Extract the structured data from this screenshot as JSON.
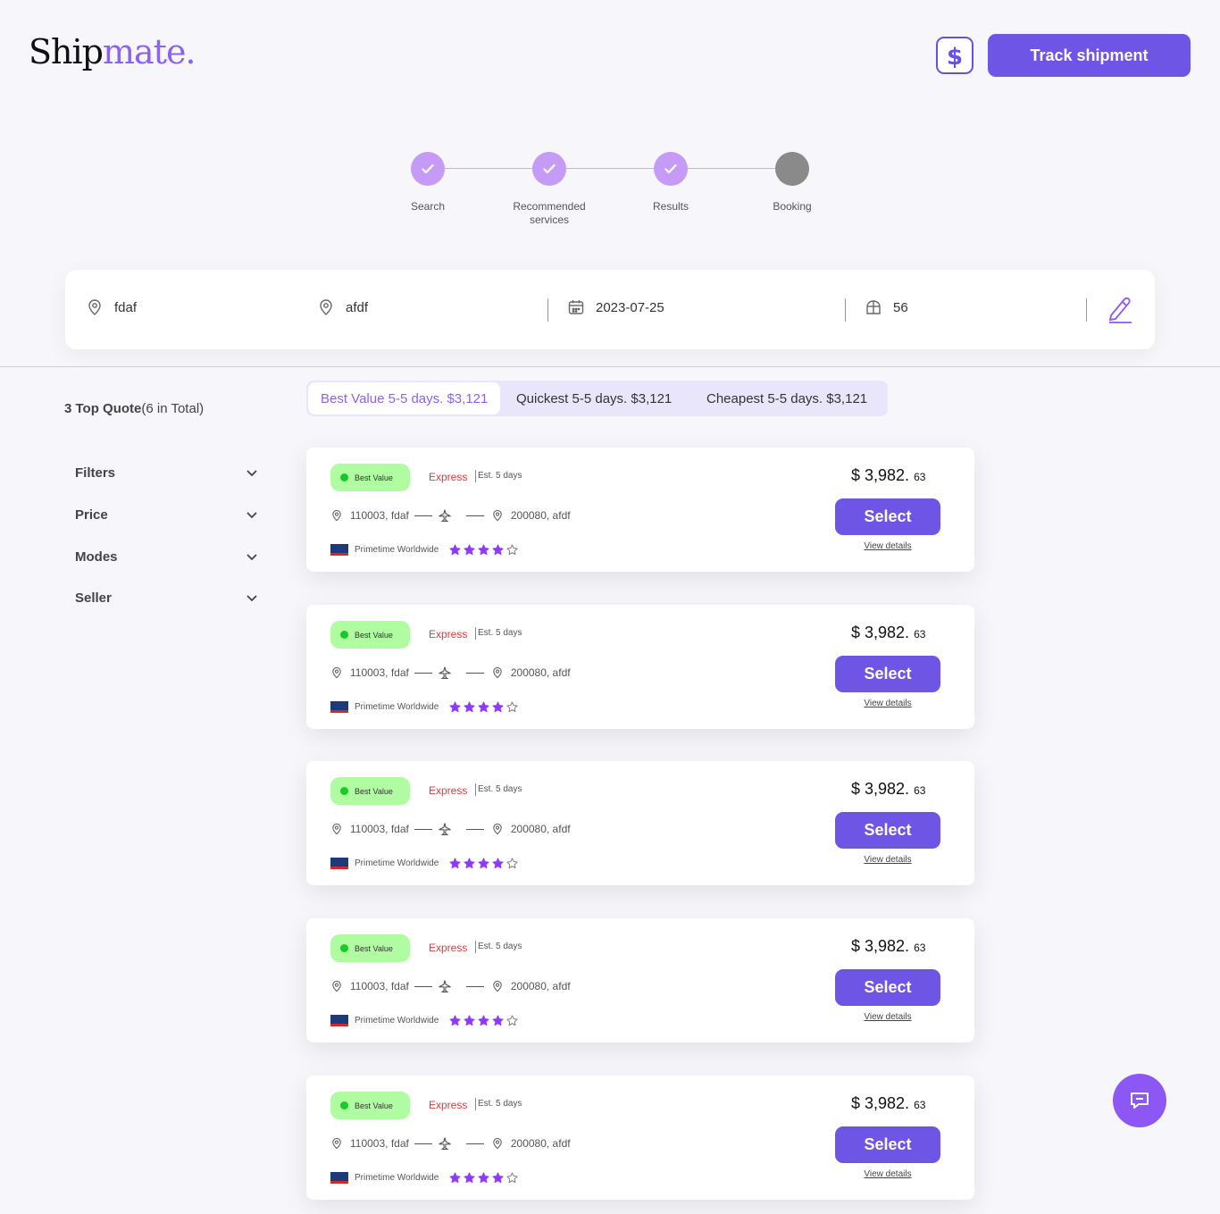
{
  "brand": {
    "part1": "Ship",
    "part2": "mate."
  },
  "header": {
    "track_label": "Track shipment"
  },
  "steps": [
    {
      "label": "Search",
      "done": true
    },
    {
      "label": "Recommended services",
      "done": true
    },
    {
      "label": "Results",
      "done": true
    },
    {
      "label": "Booking",
      "done": false
    }
  ],
  "search": {
    "origin": "fdaf",
    "destination": "afdf",
    "date": "2023-07-25",
    "weight": "56"
  },
  "summary": {
    "bold": "3 Top Quote",
    "rest": "(6 in Total)"
  },
  "filters": [
    "Filters",
    "Price",
    "Modes",
    "Seller"
  ],
  "tabs": [
    {
      "label": "Best Value 5-5 days. $3,121",
      "active": true
    },
    {
      "label": "Quickest 5-5 days. $3,121",
      "active": false
    },
    {
      "label": "Cheapest 5-5 days. $3,121",
      "active": false
    }
  ],
  "quotes": [
    {
      "badge": "Best Value",
      "mode": "Express",
      "eta": "Est. 5 days",
      "from": "110003, fdaf",
      "to": "200080, afdf",
      "carrier": "Primetime Worldwide",
      "rating": 4,
      "price_main": "$ 3,982.",
      "price_cents": "63",
      "select_label": "Select",
      "details_label": "View details"
    },
    {
      "badge": "Best Value",
      "mode": "Express",
      "eta": "Est. 5 days",
      "from": "110003, fdaf",
      "to": "200080, afdf",
      "carrier": "Primetime Worldwide",
      "rating": 4,
      "price_main": "$ 3,982.",
      "price_cents": "63",
      "select_label": "Select",
      "details_label": "View details"
    },
    {
      "badge": "Best Value",
      "mode": "Express",
      "eta": "Est. 5 days",
      "from": "110003, fdaf",
      "to": "200080, afdf",
      "carrier": "Primetime Worldwide",
      "rating": 4,
      "price_main": "$ 3,982.",
      "price_cents": "63",
      "select_label": "Select",
      "details_label": "View details"
    },
    {
      "badge": "Best Value",
      "mode": "Express",
      "eta": "Est. 5 days",
      "from": "110003, fdaf",
      "to": "200080, afdf",
      "carrier": "Primetime Worldwide",
      "rating": 4,
      "price_main": "$ 3,982.",
      "price_cents": "63",
      "select_label": "Select",
      "details_label": "View details"
    },
    {
      "badge": "Best Value",
      "mode": "Express",
      "eta": "Est. 5 days",
      "from": "110003, fdaf",
      "to": "200080, afdf",
      "carrier": "Primetime Worldwide",
      "rating": 4,
      "price_main": "$ 3,982.",
      "price_cents": "63",
      "select_label": "Select",
      "details_label": "View details"
    }
  ],
  "colors": {
    "accent": "#6f55e6",
    "brand_purple": "#8a63f0",
    "step_done": "#c59bf7",
    "badge_bg": "#b0fca0",
    "express": "#e4373a",
    "star": "#8d3cf5"
  },
  "icons": {
    "currency": "dollar-icon",
    "location": "location-pin-icon",
    "calendar": "calendar-icon",
    "package": "package-icon",
    "edit": "pencil-icon",
    "plane": "airplane-icon",
    "chat": "chat-icon",
    "chevron": "chevron-down-icon",
    "check": "check-icon",
    "star": "star-icon"
  }
}
